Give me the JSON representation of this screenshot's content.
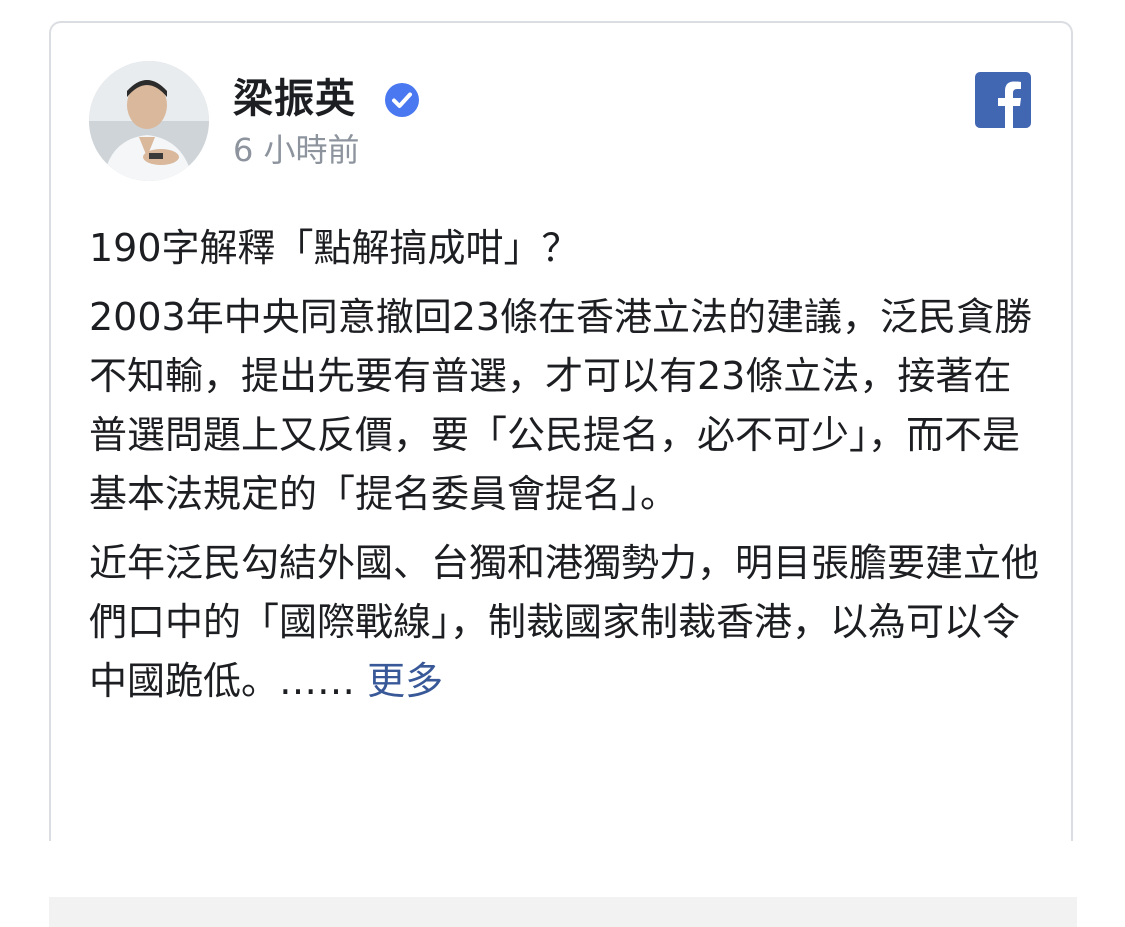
{
  "post": {
    "author": "梁振英",
    "time": "6 小時前",
    "paragraphs": [
      "190字解釋「點解搞成咁」？",
      "2003年中央同意撤回23條在香港立法的建議，泛民貪勝不知輸，提出先要有普選，才可以有23條立法，接著在普選問題上又反價，要「公民提名，必不可少」，而不是基本法規定的「提名委員會提名」。",
      "近年泛民勾結外國、台獨和港獨勢力，明目張膽要建立他們口中的「國際戰線」，制裁國家制裁香港，以為可以令中國跪低。……"
    ],
    "more_label": "更多"
  },
  "icons": {
    "verified": "verified-badge-icon",
    "platform": "facebook-icon"
  },
  "colors": {
    "verified_blue": "#4a78f0",
    "facebook_blue": "#4267b2",
    "link": "#385898",
    "muted_text": "#8d949e"
  }
}
